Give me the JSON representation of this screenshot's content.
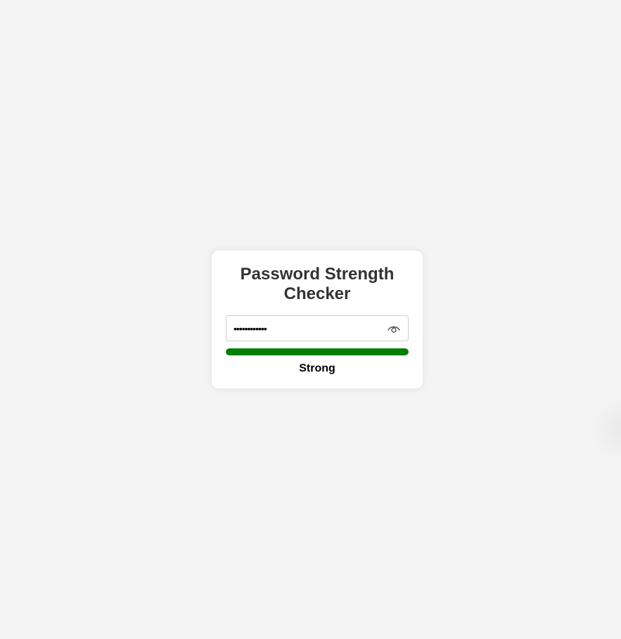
{
  "checker": {
    "title": "Password Strength Checker",
    "password_value": "••••••••••••",
    "toggle_icon": "eye-icon",
    "strength": {
      "label": "Strong",
      "level": 1.0,
      "color": "#008000"
    }
  }
}
